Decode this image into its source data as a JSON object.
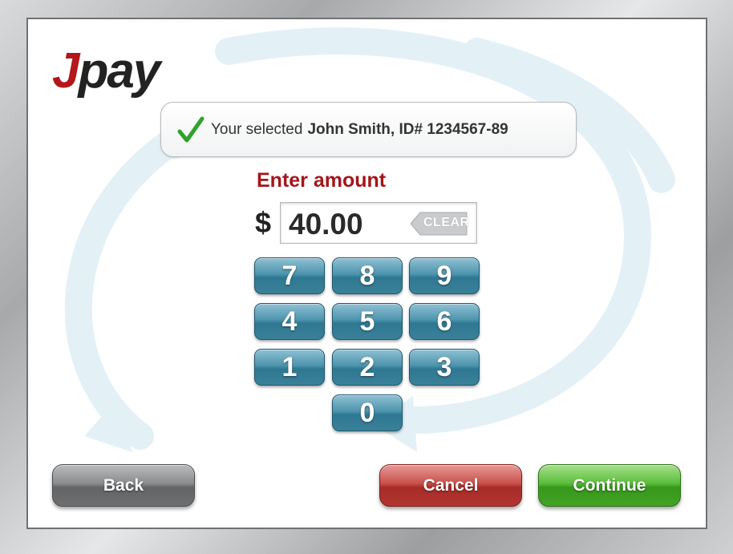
{
  "brand": {
    "logo_initial": "J",
    "logo_rest": "pay",
    "accent_red": "#b3171b"
  },
  "selection": {
    "prefix": "Your selected",
    "recipient": "John Smith, ID# 1234567-89",
    "icon": "checkmark-icon"
  },
  "amount": {
    "label": "Enter amount",
    "currency": "$",
    "value": "40.00",
    "clear_label": "CLEAR"
  },
  "keypad": {
    "keys": [
      "7",
      "8",
      "9",
      "4",
      "5",
      "6",
      "1",
      "2",
      "3",
      "0"
    ],
    "color": "#3a8099"
  },
  "actions": {
    "back_label": "Back",
    "cancel_label": "Cancel",
    "continue_label": "Continue"
  }
}
